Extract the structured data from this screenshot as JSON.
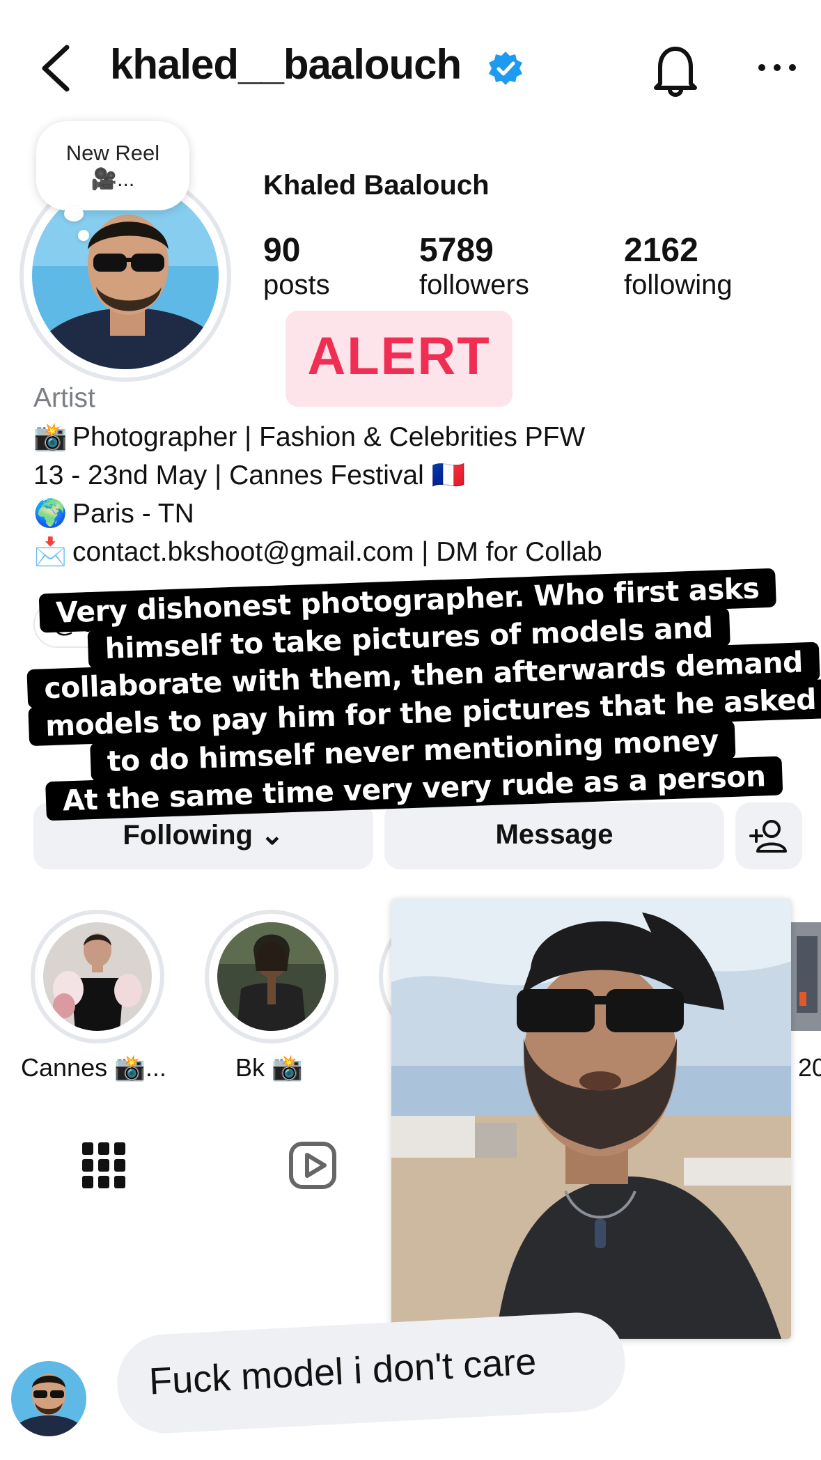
{
  "header": {
    "username": "khaled__baalouch",
    "icons": [
      "back-icon",
      "verified-badge-icon",
      "bell-icon",
      "more-icon"
    ]
  },
  "profile": {
    "reel_note": "New Reel",
    "reel_note_icon": "🎥...",
    "display_name": "Khaled Baalouch",
    "stats": {
      "posts_count": "90",
      "posts_label": "posts",
      "followers_count": "5789",
      "followers_label": "followers",
      "following_count": "2162",
      "following_label": "following"
    },
    "category": "Artist",
    "bio": {
      "line1_emoji": "📸",
      "line1": "Photographer | Fashion & Celebrities PFW",
      "line2": "13 - 23nd May | Cannes Festival 🇫🇷",
      "line3_emoji": "🌍",
      "line3": "Paris - TN",
      "line4_emoji": "📩",
      "line4": "contact.bkshoot@gmail.com | DM for Collab"
    },
    "threads_chip": "@ khaled"
  },
  "alert_label": "ALERT",
  "caption": {
    "lines": [
      "Very dishonest photographer. Who first asks",
      "himself to take pictures of models and",
      "collaborate with them, then afterwards  demand",
      "models to pay him for the pictures that he asked",
      "to do himself never mentioning money",
      "At the same time very very rude as a person"
    ]
  },
  "actions": {
    "following_label": "Following",
    "message_label": "Message"
  },
  "highlights": [
    {
      "label": "Cannes 📸..."
    },
    {
      "label": "Bk 📸"
    },
    {
      "label": "20"
    }
  ],
  "comment": {
    "text": "Fuck model i don't care"
  },
  "colors": {
    "verified_blue": "#1d9bf0",
    "alert_red": "#f02d52",
    "alert_bg": "#fde4ea",
    "button_bg": "#eff1f4"
  }
}
